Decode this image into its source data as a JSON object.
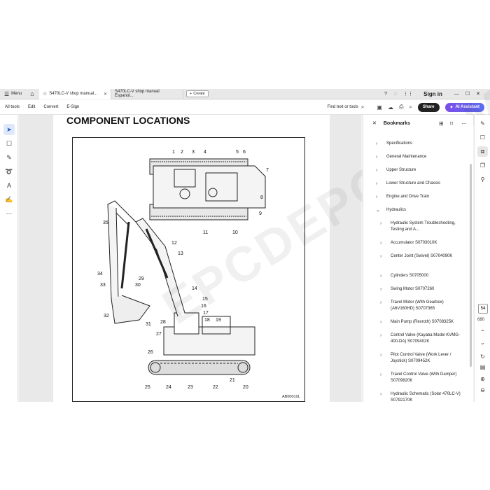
{
  "tabbar": {
    "menu_label": "Menu",
    "tabs": [
      {
        "label": "S470LC-V shop manual...",
        "active": true
      },
      {
        "label": "S470LC-V shop manual Espanol...",
        "active": false
      }
    ],
    "create_label": "Create",
    "signin_label": "Sign in"
  },
  "toolbar": {
    "menu_items": [
      "All tools",
      "Edit",
      "Convert",
      "E-Sign"
    ],
    "find_label": "Find text or tools",
    "share_label": "Share",
    "ai_label": "AI Assistant"
  },
  "document": {
    "page_title": "COMPONENT LOCATIONS",
    "figure_code": "AB00010L",
    "watermark": "EPCDEPO.COM",
    "callouts": [
      "1",
      "2",
      "3",
      "4",
      "5",
      "6",
      "7",
      "8",
      "9",
      "10",
      "11",
      "12",
      "13",
      "14",
      "15",
      "16",
      "17",
      "18",
      "19",
      "20",
      "21",
      "22",
      "23",
      "24",
      "25",
      "26",
      "27",
      "28",
      "29",
      "30",
      "31",
      "32",
      "33",
      "34",
      "35"
    ]
  },
  "bookmarks": {
    "title": "Bookmarks",
    "items": [
      {
        "label": "Specifications",
        "level": 0,
        "expanded": false
      },
      {
        "label": "General Maintenance",
        "level": 0,
        "expanded": false
      },
      {
        "label": "Upper Structure",
        "level": 0,
        "expanded": false
      },
      {
        "label": "Lower Structure and Chassis",
        "level": 0,
        "expanded": false
      },
      {
        "label": "Engine and Drive Train",
        "level": 0,
        "expanded": false
      },
      {
        "label": "Hydraulics",
        "level": 0,
        "expanded": true
      },
      {
        "label": "Hydraulic System Troubleshooting, Testing and A...",
        "level": 1,
        "expanded": false
      },
      {
        "label": "Accumulator S0703010K",
        "level": 1,
        "expanded": false
      },
      {
        "label": "Center Joint (Swivel) S0704090K",
        "level": 1,
        "expanded": false
      },
      {
        "label": "Cylinders S0705000",
        "level": 1,
        "expanded": false
      },
      {
        "label": "Swing Motor S0707260",
        "level": 1,
        "expanded": false
      },
      {
        "label": "Travel Motor (With Gearbox) (A6V160HD) S0707365",
        "level": 1,
        "expanded": false
      },
      {
        "label": "Main Pump (Rexroth) S0708325K",
        "level": 1,
        "expanded": false
      },
      {
        "label": "Control Valve (Kayaba Model KVMG-400-DA) S0709402K",
        "level": 1,
        "expanded": false
      },
      {
        "label": "Pilot Control Valve (Work Lever / Joystick) S0709452K",
        "level": 1,
        "expanded": false
      },
      {
        "label": "Travel Control Valve (With Damper) S0709820K",
        "level": 1,
        "expanded": false
      },
      {
        "label": "Hydraulic Schematic (Solar 470LC-V) S0792170K",
        "level": 1,
        "expanded": false
      }
    ]
  },
  "pager": {
    "current": "54",
    "total": "680"
  }
}
